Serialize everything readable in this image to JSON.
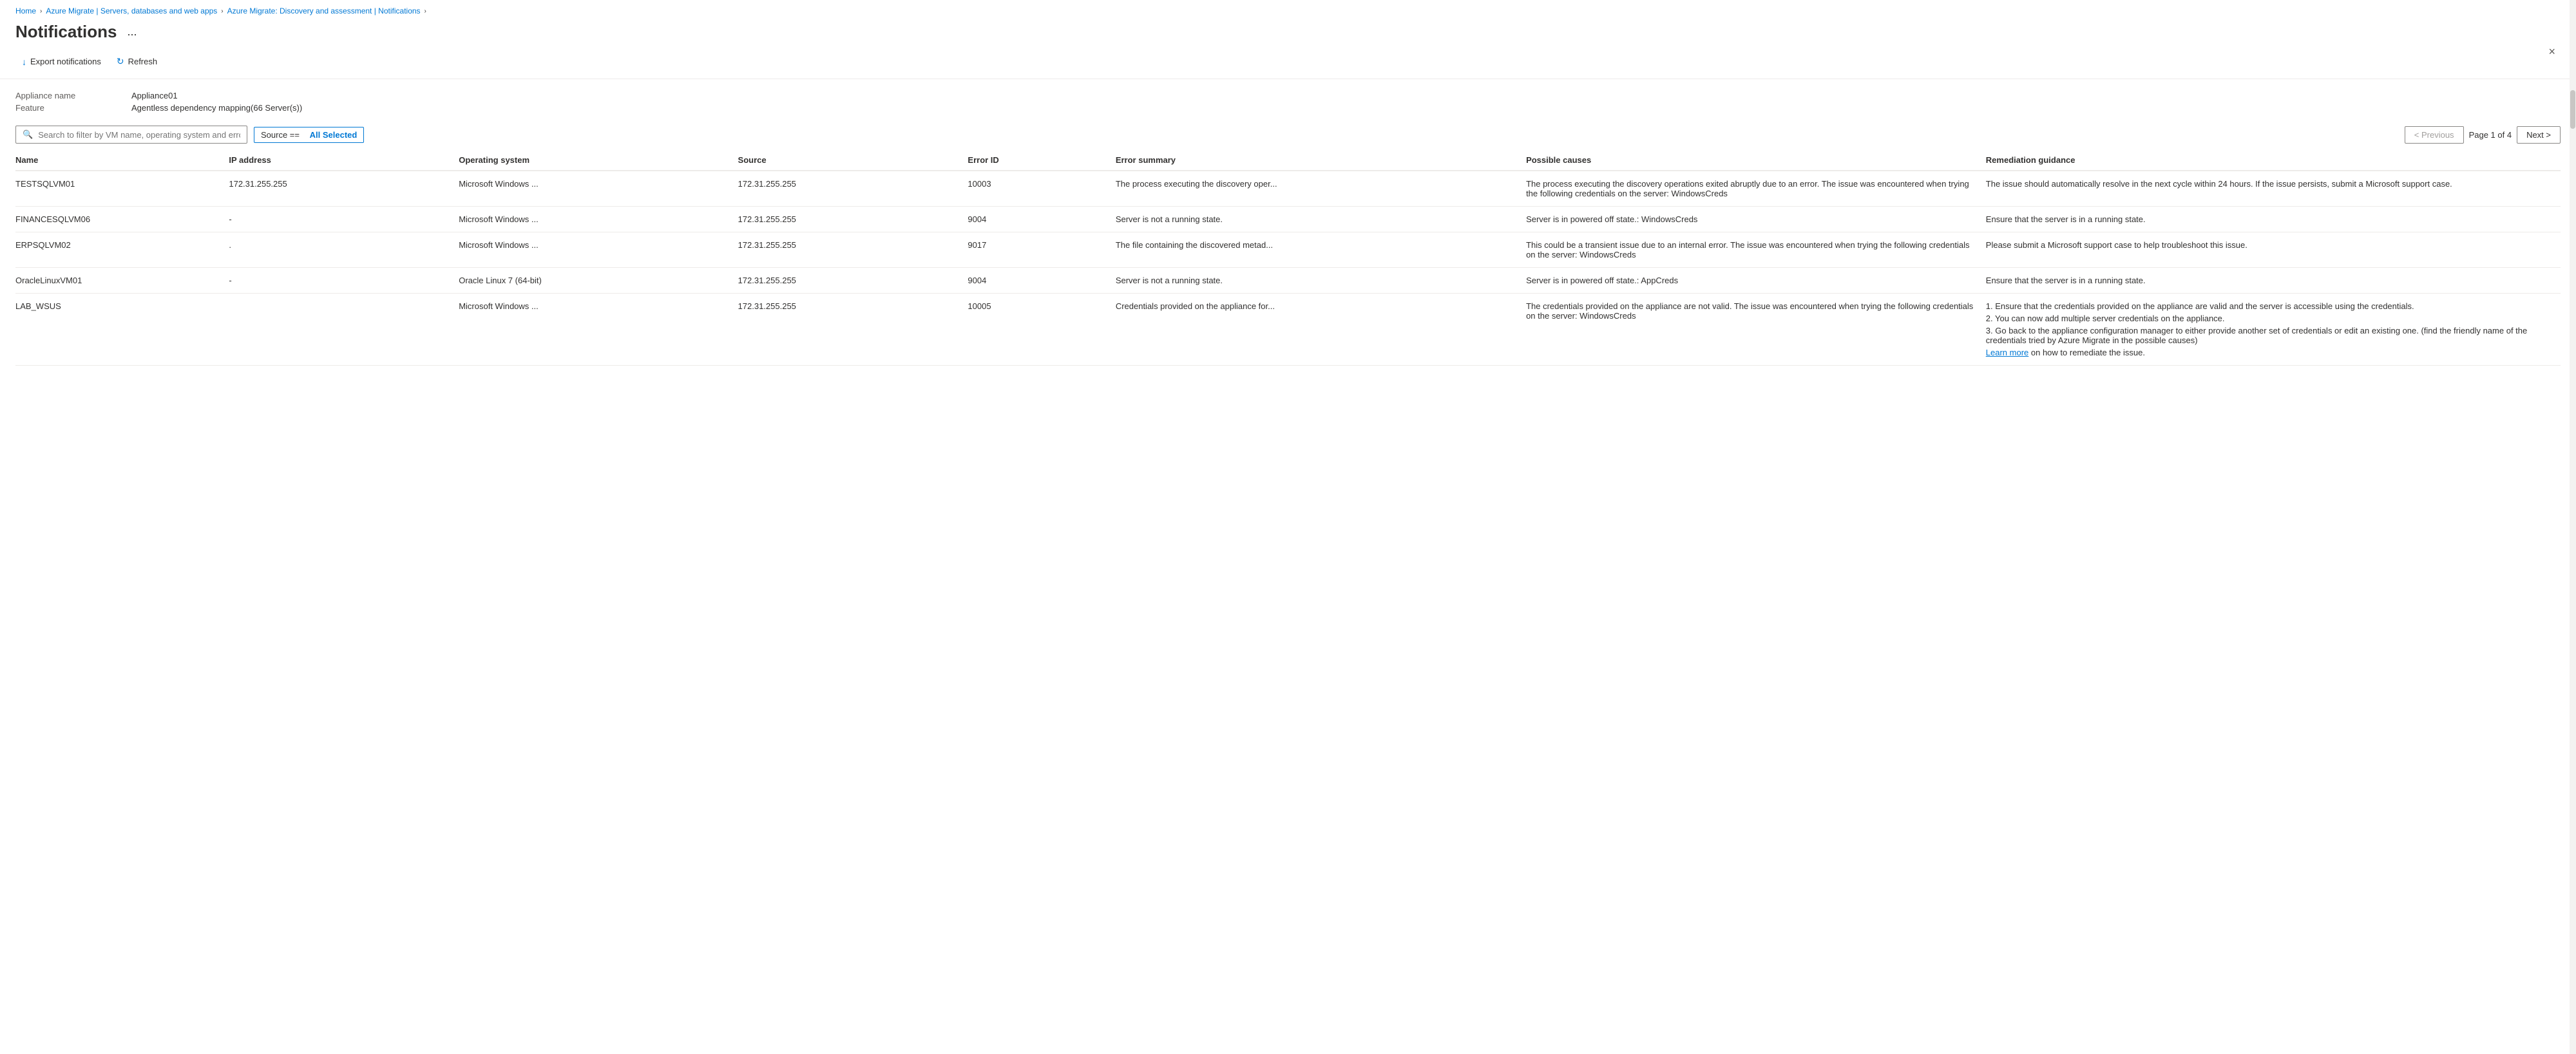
{
  "breadcrumb": {
    "items": [
      {
        "label": "Home",
        "sep": true
      },
      {
        "label": "Azure Migrate | Servers, databases and web apps",
        "sep": true
      },
      {
        "label": "Azure Migrate: Discovery and assessment | Notifications",
        "sep": true
      }
    ]
  },
  "header": {
    "title": "Notifications",
    "more_label": "...",
    "close_label": "×"
  },
  "toolbar": {
    "export_label": "Export notifications",
    "refresh_label": "Refresh"
  },
  "meta": {
    "appliance_label": "Appliance name",
    "appliance_value": "Appliance01",
    "feature_label": "Feature",
    "feature_value": "Agentless dependency mapping(66 Server(s))"
  },
  "search": {
    "placeholder": "Search to filter by VM name, operating system and error ID"
  },
  "filter_tag": {
    "prefix": "Source ==",
    "value": "All Selected"
  },
  "pagination": {
    "previous_label": "< Previous",
    "next_label": "Next >",
    "page_info": "Page 1 of 4"
  },
  "table": {
    "columns": [
      {
        "key": "name",
        "label": "Name"
      },
      {
        "key": "ip",
        "label": "IP address"
      },
      {
        "key": "os",
        "label": "Operating system"
      },
      {
        "key": "source",
        "label": "Source"
      },
      {
        "key": "errorid",
        "label": "Error ID"
      },
      {
        "key": "summary",
        "label": "Error summary"
      },
      {
        "key": "causes",
        "label": "Possible causes"
      },
      {
        "key": "remediation",
        "label": "Remediation guidance"
      }
    ],
    "rows": [
      {
        "name": "TESTSQLVM01",
        "ip": "172.31.255.255",
        "os": "Microsoft Windows ...",
        "source": "172.31.255.255",
        "errorid": "10003",
        "summary": "The process executing the discovery oper...",
        "causes": "The process executing the discovery operations exited abruptly due to an error. The issue was encountered when trying the following credentials on the server: WindowsCreds",
        "remediation": "The issue should automatically resolve in the next cycle within 24 hours. If the issue persists, submit a Microsoft support case."
      },
      {
        "name": "FINANCESQLVM06",
        "ip": "-",
        "os": "Microsoft Windows ...",
        "source": "172.31.255.255",
        "errorid": "9004",
        "summary": "Server is not a running state.",
        "causes": "Server is in powered off state.: WindowsCreds",
        "remediation": "Ensure that the server is in a running state."
      },
      {
        "name": "ERPSQLVM02",
        "ip": ".",
        "os": "Microsoft Windows ...",
        "source": "172.31.255.255",
        "errorid": "9017",
        "summary": "The file containing the discovered metad...",
        "causes": "This could be a transient issue due to an internal error. The issue was encountered when trying the following credentials on the server: WindowsCreds",
        "remediation": "Please submit a Microsoft support case to help troubleshoot this issue."
      },
      {
        "name": "OracleLinuxVM01",
        "ip": "-",
        "os": "Oracle Linux 7 (64-bit)",
        "source": "172.31.255.255",
        "errorid": "9004",
        "summary": "Server is not a running state.",
        "causes": "Server is in powered off state.: AppCreds",
        "remediation": "Ensure that the server is in a running state."
      },
      {
        "name": "LAB_WSUS",
        "ip": "",
        "os": "Microsoft Windows ...",
        "source": "172.31.255.255",
        "errorid": "10005",
        "summary": "Credentials provided on the appliance for...",
        "causes": "The credentials provided on the appliance are not valid. The issue was encountered when trying the following credentials on the server: WindowsCreds",
        "remediation_parts": [
          "1. Ensure that the credentials provided on the appliance are valid and the server is accessible using the credentials.",
          "2. You can now add multiple server credentials on the appliance.",
          "3. Go back to the appliance configuration manager to either provide another set of credentials or edit an existing one. (find the friendly name of the credentials tried by Azure Migrate in the possible causes)"
        ],
        "remediation_link": "Learn more",
        "remediation_link_suffix": " on how to remediate the issue."
      }
    ]
  }
}
